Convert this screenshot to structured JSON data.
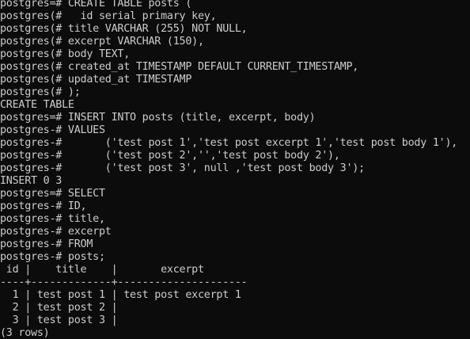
{
  "terminal": {
    "lines": [
      "postgres=# CREATE TABLE posts (",
      "postgres(#   id serial primary key,",
      "postgres(# title VARCHAR (255) NOT NULL,",
      "postgres(# excerpt VARCHAR (150),",
      "postgres(# body TEXT,",
      "postgres(# created_at TIMESTAMP DEFAULT CURRENT_TIMESTAMP,",
      "postgres(# updated_at TIMESTAMP",
      "postgres(# );",
      "CREATE TABLE",
      "postgres=# INSERT INTO posts (title, excerpt, body)",
      "postgres-# VALUES",
      "postgres-#       ('test post 1','test post excerpt 1','test post body 1'),",
      "postgres-#       ('test post 2','','test post body 2'),",
      "postgres-#       ('test post 3', null ,'test post body 3');",
      "INSERT 0 3",
      "postgres=# SELECT",
      "postgres-# ID,",
      "postgres-# title,",
      "postgres-# excerpt",
      "postgres-# FROM",
      "postgres-# posts;",
      " id |    title    |       excerpt",
      "----+-------------+---------------------",
      "  1 | test post 1 | test post excerpt 1",
      "  2 | test post 2 |",
      "  3 | test post 3 |",
      "(3 rows)"
    ]
  },
  "colors": {
    "background": "#0c0c0c",
    "foreground": "#cccccc"
  }
}
